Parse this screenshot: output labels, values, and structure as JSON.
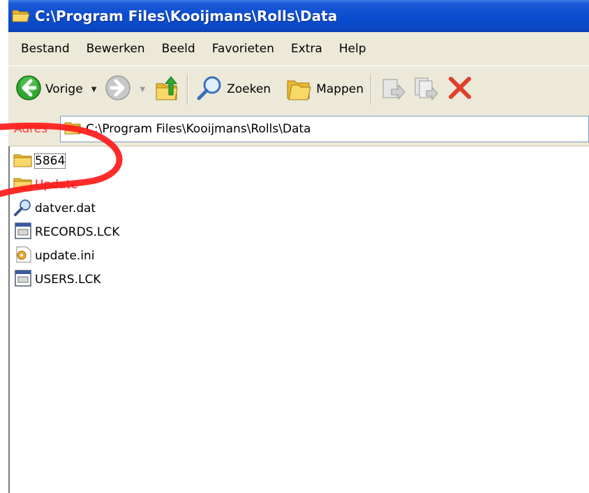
{
  "window": {
    "title": "C:\\Program Files\\Kooijmans\\Rolls\\Data"
  },
  "menu": {
    "items": [
      "Bestand",
      "Bewerken",
      "Beeld",
      "Favorieten",
      "Extra",
      "Help"
    ]
  },
  "toolbar": {
    "back_label": "Vorige",
    "search_label": "Zoeken",
    "folders_label": "Mappen"
  },
  "address": {
    "label": "Adres",
    "path": "C:\\Program Files\\Kooijmans\\Rolls\\Data"
  },
  "files": [
    {
      "name": "5864",
      "type": "folder"
    },
    {
      "name": "Update",
      "type": "folder"
    },
    {
      "name": "datver.dat",
      "type": "dat"
    },
    {
      "name": "RECORDS.LCK",
      "type": "lck"
    },
    {
      "name": "update.ini",
      "type": "ini"
    },
    {
      "name": "USERS.LCK",
      "type": "lck"
    }
  ],
  "colors": {
    "titlebar": "#0a4cd0",
    "annotation": "#ff1a1a",
    "chrome": "#ece9d8"
  }
}
